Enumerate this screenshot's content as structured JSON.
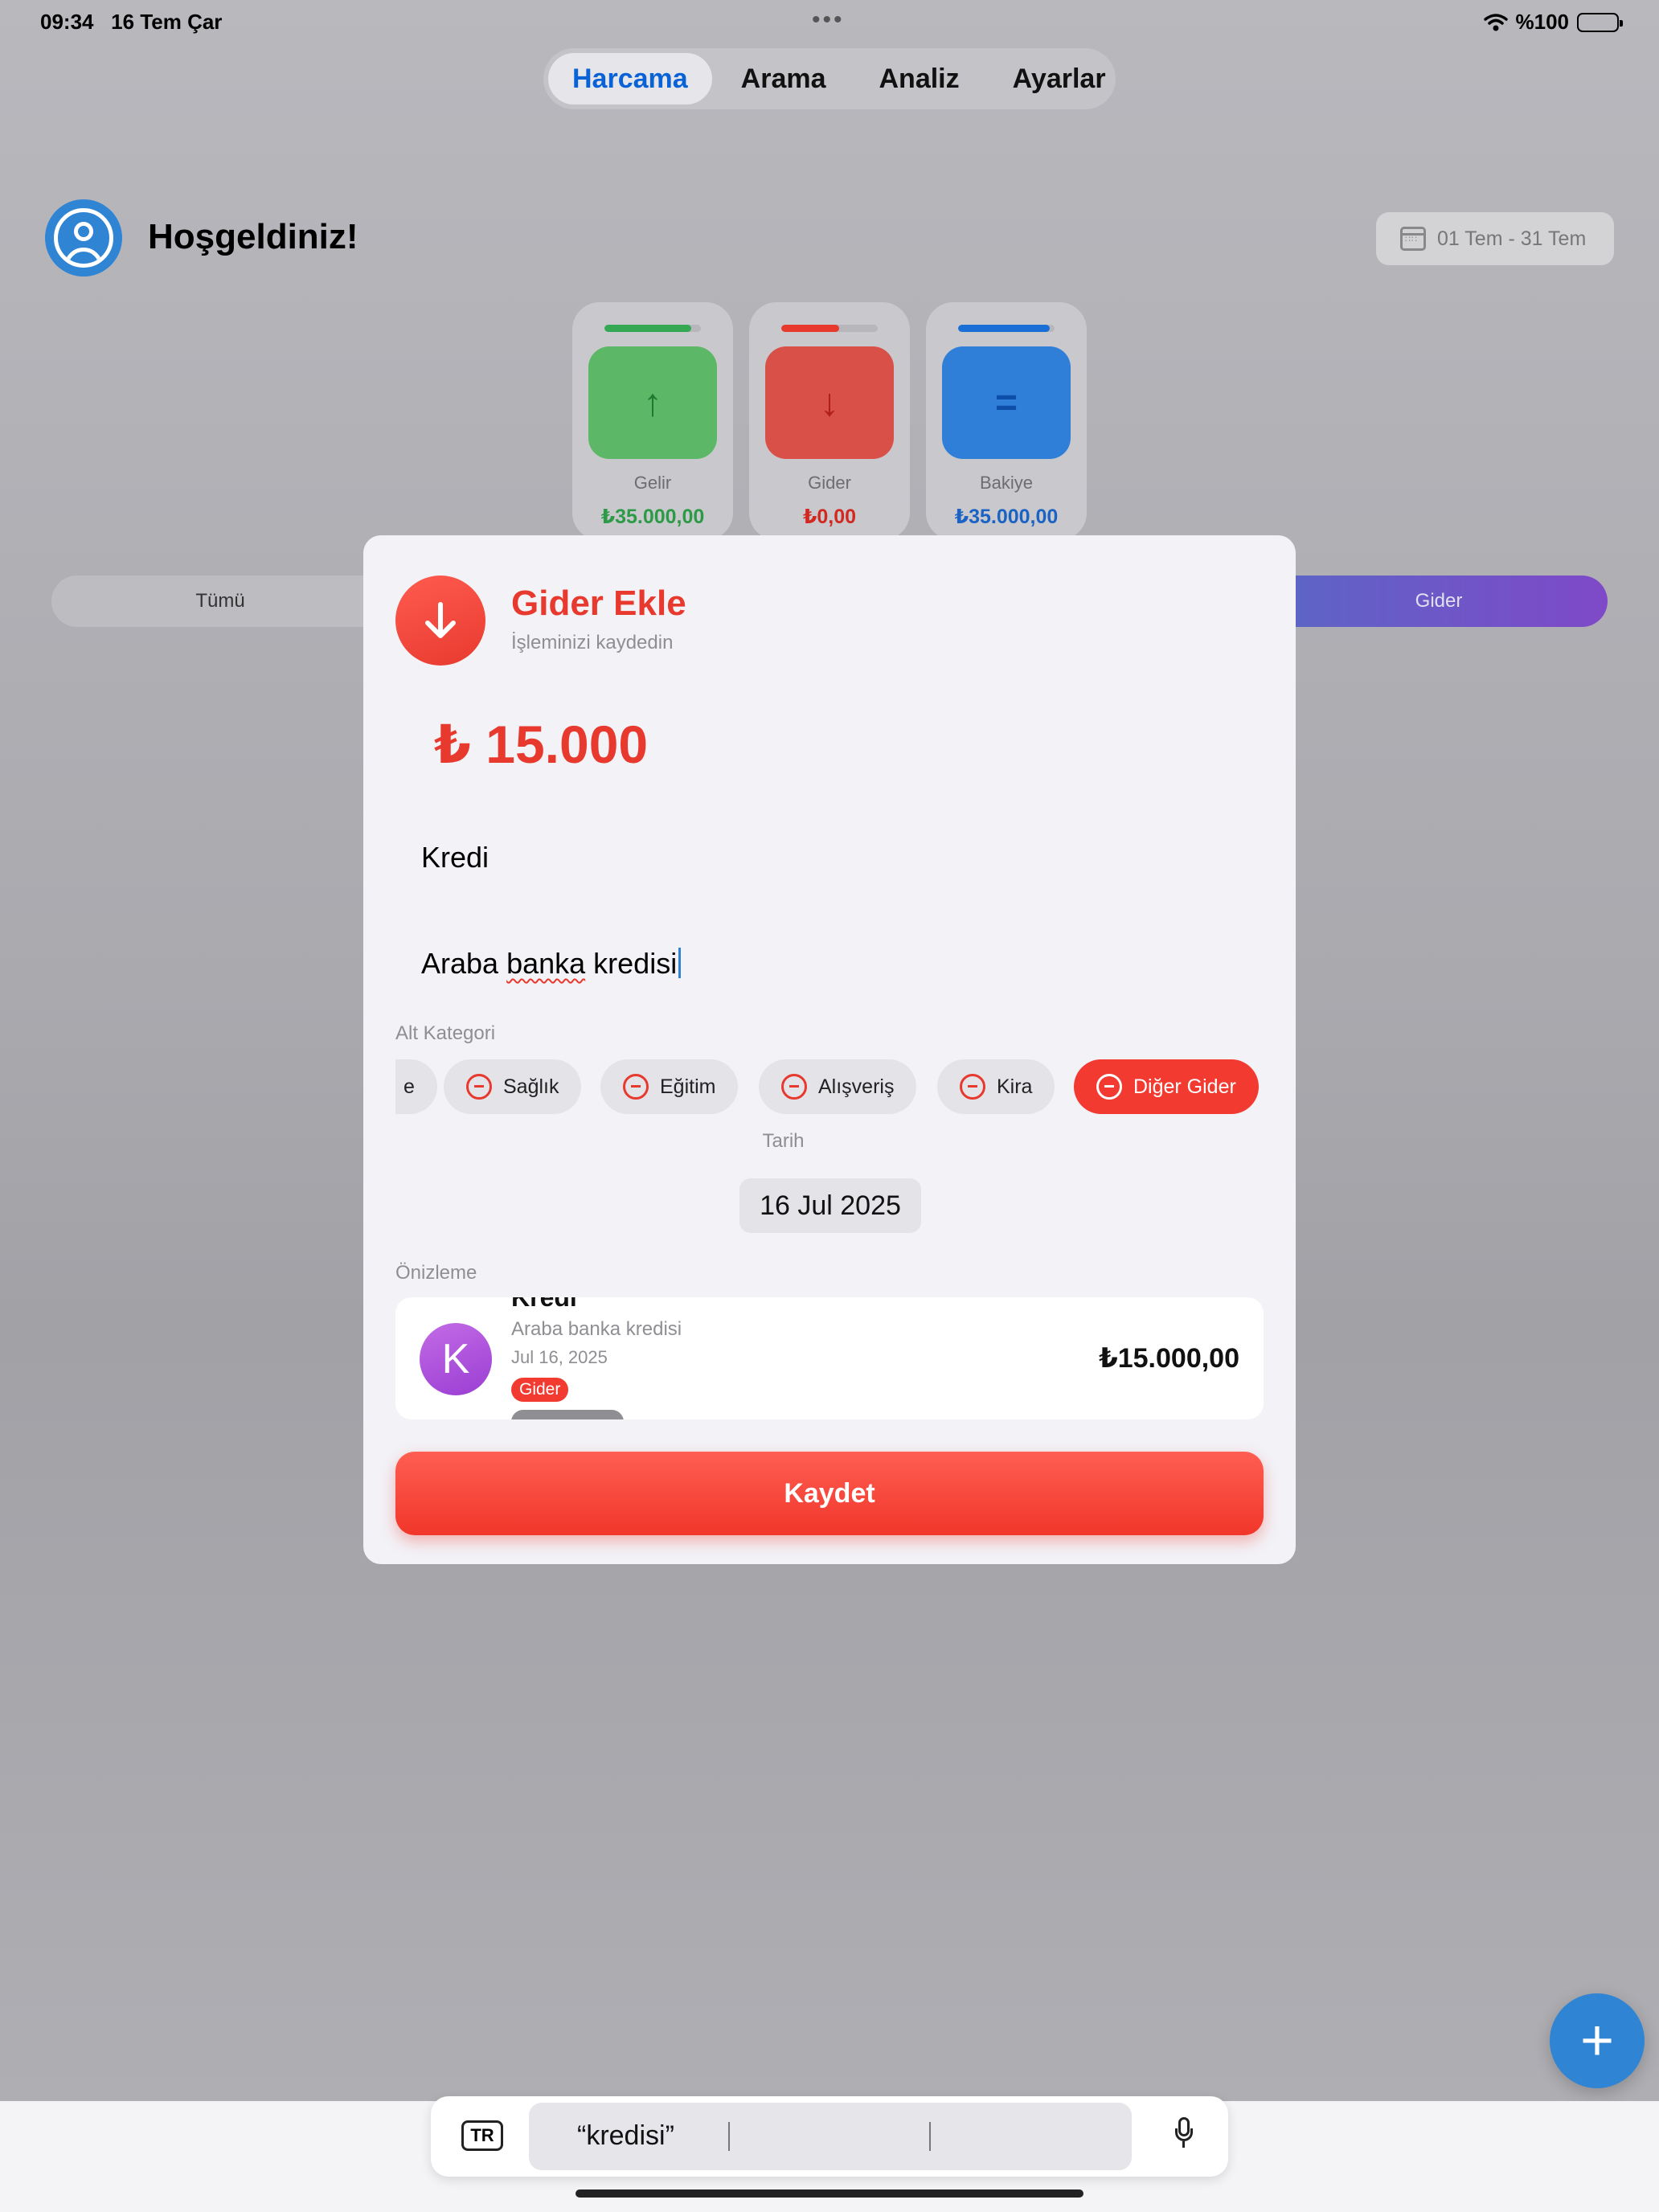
{
  "status": {
    "time": "09:34",
    "date": "16 Tem Çar",
    "battery": "%100"
  },
  "tabs": [
    {
      "label": "Harcama",
      "active": true
    },
    {
      "label": "Arama",
      "active": false
    },
    {
      "label": "Analiz",
      "active": false
    },
    {
      "label": "Ayarlar",
      "active": false
    }
  ],
  "header": {
    "welcome": "Hoşgeldiniz!",
    "date_range": "01 Tem - 31 Tem"
  },
  "cards": [
    {
      "label": "Gelir",
      "amount": "₺35.000,00",
      "icon": "arrow-up-icon",
      "color": "#34a853",
      "progress": 0.9
    },
    {
      "label": "Gider",
      "amount": "₺0,00",
      "icon": "arrow-down-icon",
      "color": "#e8392e",
      "progress": 0.6
    },
    {
      "label": "Bakiye",
      "amount": "₺35.000,00",
      "icon": "equals-icon",
      "color": "#1a6fd6",
      "progress": 0.95
    }
  ],
  "filters": {
    "left": "Tümü",
    "right": "Gider"
  },
  "modal": {
    "title": "Gider Ekle",
    "subtitle": "İşleminizi kaydedin",
    "amount": "₺ 15.000",
    "title_value": "Kredi",
    "description_value": "Araba banka kredisi",
    "subcategory_label": "Alt Kategori",
    "subcategories": [
      {
        "label": "e",
        "selected": false
      },
      {
        "label": "Sağlık",
        "selected": false
      },
      {
        "label": "Eğitim",
        "selected": false
      },
      {
        "label": "Alışveriş",
        "selected": false
      },
      {
        "label": "Kira",
        "selected": false
      },
      {
        "label": "Diğer Gider",
        "selected": true
      }
    ],
    "date_label": "Tarih",
    "date_value": "16 Jul 2025",
    "preview_label": "Önizleme",
    "preview": {
      "initial": "K",
      "title": "Kredi",
      "description": "Araba banka kredisi",
      "date": "Jul 16, 2025",
      "badge": "Gider",
      "amount": "₺15.000,00"
    },
    "save_label": "Kaydet"
  },
  "keyboard": {
    "lang": "TR",
    "suggestion": "“kredisi”"
  },
  "colors": {
    "accent_red": "#e8392e",
    "accent_blue": "#2f84d3",
    "tab_active": "#0a63d6"
  }
}
